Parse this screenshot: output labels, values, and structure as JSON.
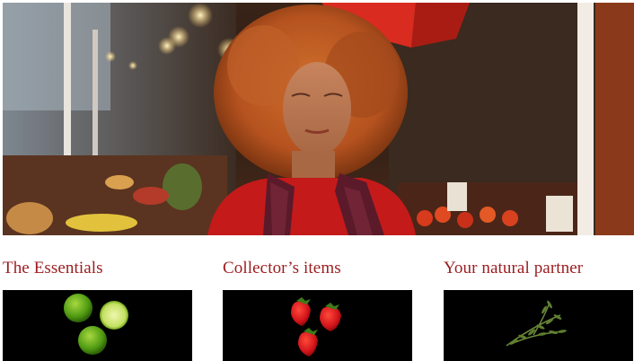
{
  "hero": {
    "image": "photo-woman-in-market",
    "colors": {
      "hair": "#b5521f",
      "top": "#c41a1a",
      "awning": "#d92b1f"
    }
  },
  "cards": [
    {
      "title": "The Essentials",
      "image": "limes-on-black"
    },
    {
      "title": "Collector’s items",
      "image": "strawberries-on-black"
    },
    {
      "title": "Your natural partner",
      "image": "rosemary-on-black"
    }
  ],
  "accent_color": "#9b1c1f"
}
